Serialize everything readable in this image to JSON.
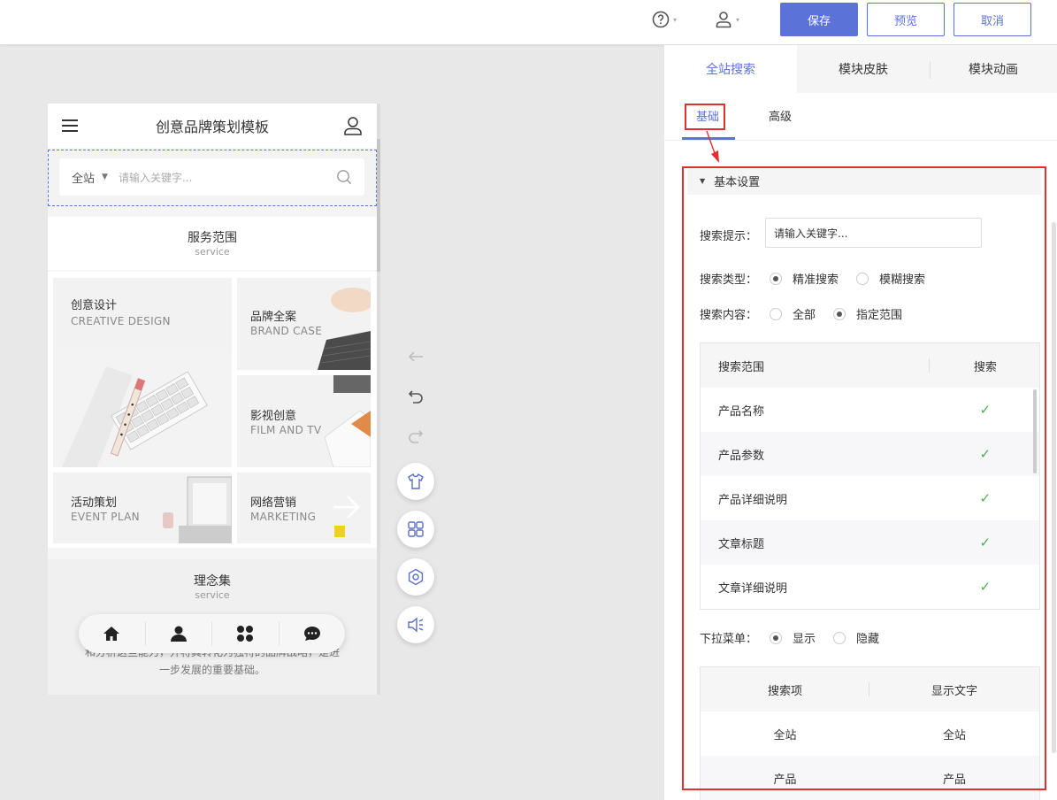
{
  "toolbar": {
    "help_icon": "help-circle-icon",
    "user_icon": "user-icon",
    "save_label": "保存",
    "preview_label": "预览",
    "cancel_label": "取消"
  },
  "phone": {
    "title": "创意品牌策划模板",
    "search_scope": "全站",
    "search_placeholder": "请输入关键字...",
    "service_section": {
      "title": "服务范围",
      "subtitle": "service"
    },
    "cards": [
      {
        "title": "创意设计",
        "subtitle": "CREATIVE DESIGN"
      },
      {
        "title": "品牌全案",
        "subtitle": "BRAND CASE"
      },
      {
        "title": "影视创意",
        "subtitle": "FILM AND TV"
      },
      {
        "title": "活动策划",
        "subtitle": "EVENT PLAN"
      },
      {
        "title": "网络营销",
        "subtitle": "MARKETING"
      }
    ],
    "concept_section": {
      "title": "理念集",
      "subtitle": "service"
    },
    "concept_text_line1": "和分析这些能力，并将其转化为独特的品牌战略，是进",
    "concept_text_line2": "一步发展的重要基础。",
    "nav_icons": [
      "home-icon",
      "person-icon",
      "apps-icon",
      "chat-icon"
    ]
  },
  "side_tools": [
    "back-arrow-icon",
    "undo-icon",
    "redo-icon",
    "shirt-icon",
    "grid-icon",
    "settings-icon",
    "speaker-icon"
  ],
  "panel": {
    "tabs": [
      {
        "label": "全站搜索",
        "active": true
      },
      {
        "label": "模块皮肤",
        "active": false
      },
      {
        "label": "模块动画",
        "active": false
      }
    ],
    "subtabs": [
      {
        "label": "基础",
        "active": true
      },
      {
        "label": "高级",
        "active": false
      }
    ],
    "group_title": "基本设置",
    "search_hint_label": "搜索提示：",
    "search_hint_value": "请输入关键字...",
    "search_type_label": "搜索类型：",
    "search_type_options": [
      "精准搜索",
      "模糊搜索"
    ],
    "search_type_selected": "精准搜索",
    "search_content_label": "搜索内容：",
    "search_content_options": [
      "全部",
      "指定范围"
    ],
    "search_content_selected": "指定范围",
    "scope_table": {
      "headers": [
        "搜索范围",
        "搜索"
      ],
      "rows": [
        {
          "name": "产品名称",
          "checked": true
        },
        {
          "name": "产品参数",
          "checked": true
        },
        {
          "name": "产品详细说明",
          "checked": true
        },
        {
          "name": "文章标题",
          "checked": true
        },
        {
          "name": "文章详细说明",
          "checked": true
        }
      ]
    },
    "dropdown_label": "下拉菜单：",
    "dropdown_options": [
      "显示",
      "隐藏"
    ],
    "dropdown_selected": "显示",
    "dropdown_table": {
      "headers": [
        "搜索项",
        "显示文字"
      ],
      "rows": [
        [
          "全站",
          "全站"
        ],
        [
          "产品",
          "产品"
        ]
      ]
    },
    "check_mark": "✓",
    "highlight_color": "#e03030",
    "accent_color": "#5b73d9"
  }
}
